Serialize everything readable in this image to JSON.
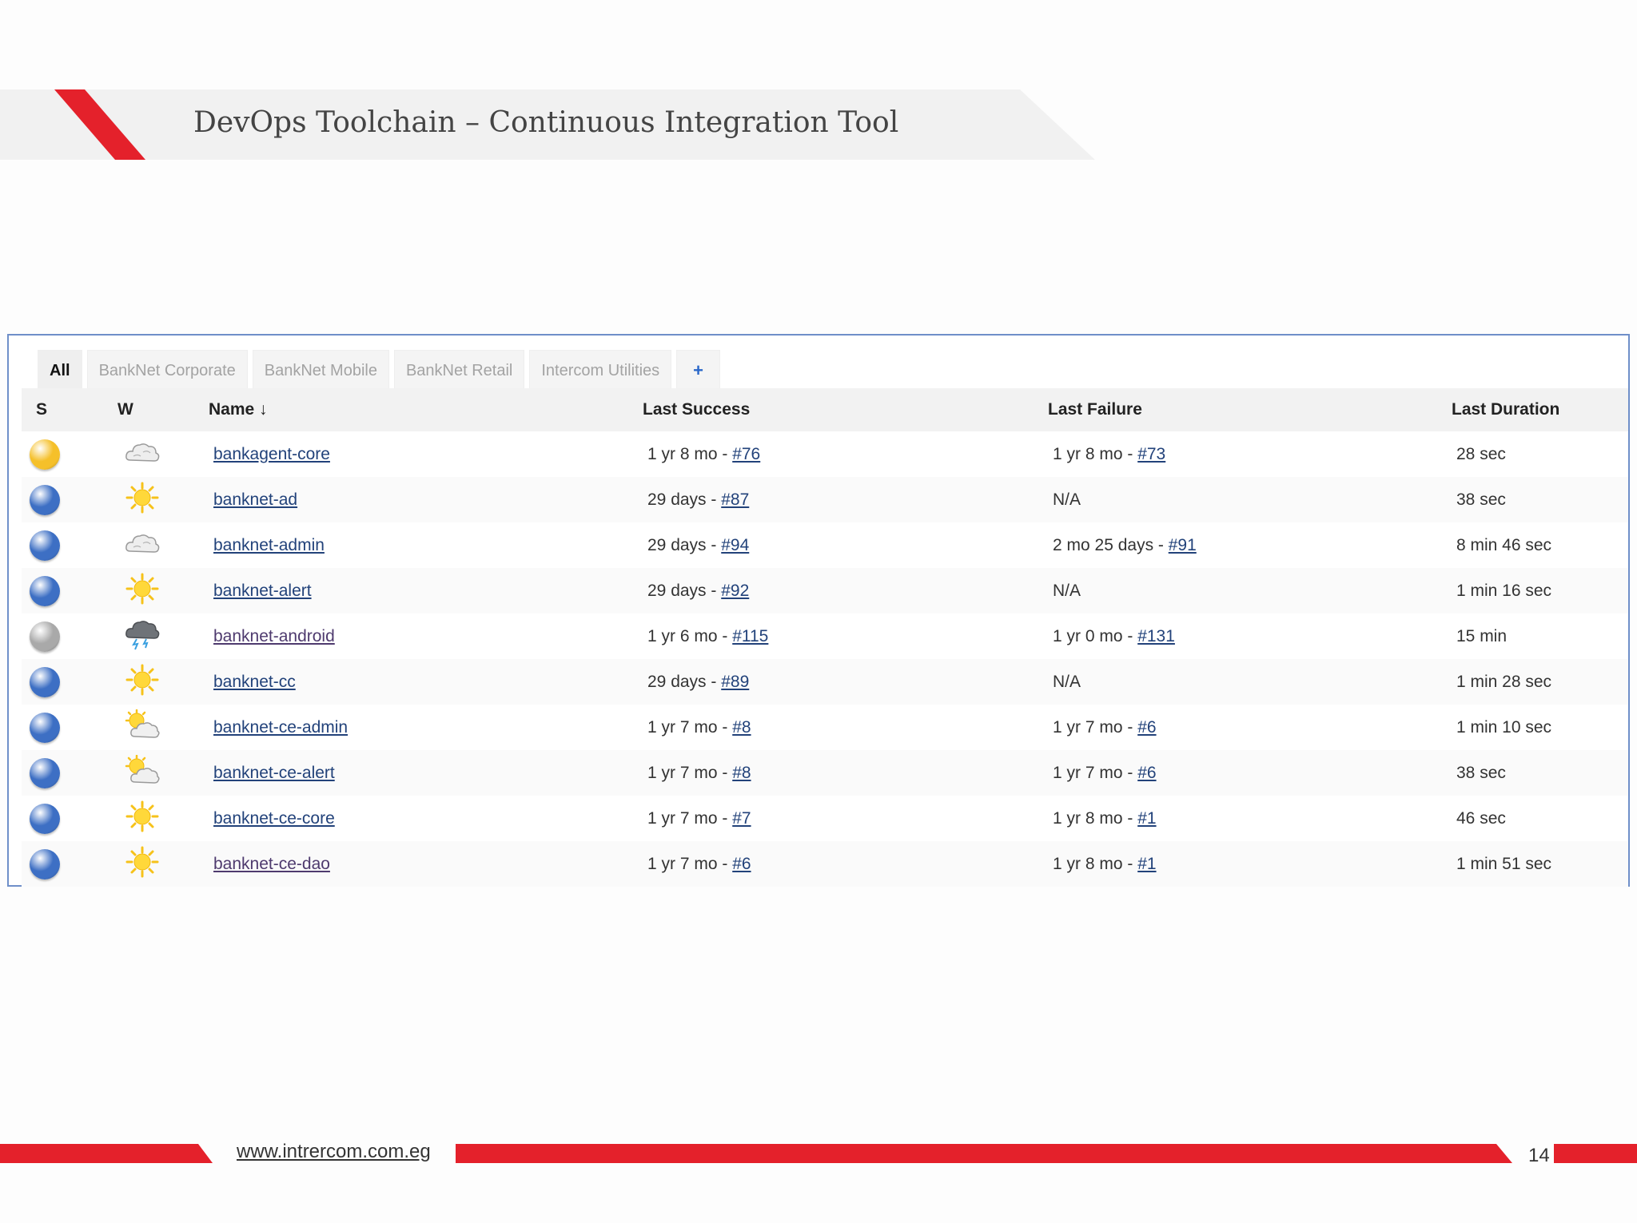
{
  "slide": {
    "title": "DevOps Toolchain – Continuous Integration Tool",
    "footer_url": "www.intrercom.com.eg",
    "page_number": "14",
    "accent_color": "#e4212b"
  },
  "tabs": [
    {
      "label": "All",
      "active": true
    },
    {
      "label": "BankNet Corporate",
      "active": false
    },
    {
      "label": "BankNet Mobile",
      "active": false
    },
    {
      "label": "BankNet Retail",
      "active": false
    },
    {
      "label": "Intercom Utilities",
      "active": false
    },
    {
      "label": "+",
      "active": false
    }
  ],
  "columns": {
    "status": "S",
    "weather": "W",
    "name": "Name ↓",
    "last_success": "Last Success",
    "last_failure": "Last Failure",
    "last_duration": "Last Duration"
  },
  "jobs": [
    {
      "status": "yellow",
      "weather": "cloudy",
      "name": "bankagent-core",
      "success_age": "1 yr 8 mo - ",
      "success_build": "#76",
      "failure_age": "1 yr 8 mo - ",
      "failure_build": "#73",
      "duration": "28 sec"
    },
    {
      "status": "blue",
      "weather": "sunny",
      "name": "banknet-ad",
      "success_age": "29 days - ",
      "success_build": "#87",
      "failure_age": "N/A",
      "failure_build": "",
      "duration": "38 sec"
    },
    {
      "status": "blue",
      "weather": "cloudy",
      "name": "banknet-admin",
      "success_age": "29 days - ",
      "success_build": "#94",
      "failure_age": "2 mo 25 days - ",
      "failure_build": "#91",
      "duration": "8 min 46 sec"
    },
    {
      "status": "blue",
      "weather": "sunny",
      "name": "banknet-alert",
      "success_age": "29 days - ",
      "success_build": "#92",
      "failure_age": "N/A",
      "failure_build": "",
      "duration": "1 min 16 sec"
    },
    {
      "status": "grey",
      "weather": "stormy",
      "name": "banknet-android",
      "success_age": "1 yr 6 mo - ",
      "success_build": "#115",
      "failure_age": "1 yr 0 mo - ",
      "failure_build": "#131",
      "duration": "15 min"
    },
    {
      "status": "blue",
      "weather": "sunny",
      "name": "banknet-cc",
      "success_age": "29 days - ",
      "success_build": "#89",
      "failure_age": "N/A",
      "failure_build": "",
      "duration": "1 min 28 sec"
    },
    {
      "status": "blue",
      "weather": "partly-cloudy",
      "name": "banknet-ce-admin",
      "success_age": "1 yr 7 mo - ",
      "success_build": "#8",
      "failure_age": "1 yr 7 mo - ",
      "failure_build": "#6",
      "duration": "1 min 10 sec"
    },
    {
      "status": "blue",
      "weather": "partly-cloudy",
      "name": "banknet-ce-alert",
      "success_age": "1 yr 7 mo - ",
      "success_build": "#8",
      "failure_age": "1 yr 7 mo - ",
      "failure_build": "#6",
      "duration": "38 sec"
    },
    {
      "status": "blue",
      "weather": "sunny",
      "name": "banknet-ce-core",
      "success_age": "1 yr 7 mo - ",
      "success_build": "#7",
      "failure_age": "1 yr 8 mo - ",
      "failure_build": "#1",
      "duration": "46 sec"
    },
    {
      "status": "blue",
      "weather": "sunny",
      "name": "banknet-ce-dao",
      "success_age": "1 yr 7 mo - ",
      "success_build": "#6",
      "failure_age": "1 yr 8 mo - ",
      "failure_build": "#1",
      "duration": "1 min 51 sec"
    }
  ],
  "status_colors": {
    "yellow": "#f5c02a",
    "blue": "#3d6fc4",
    "grey": "#a9a9a9"
  }
}
